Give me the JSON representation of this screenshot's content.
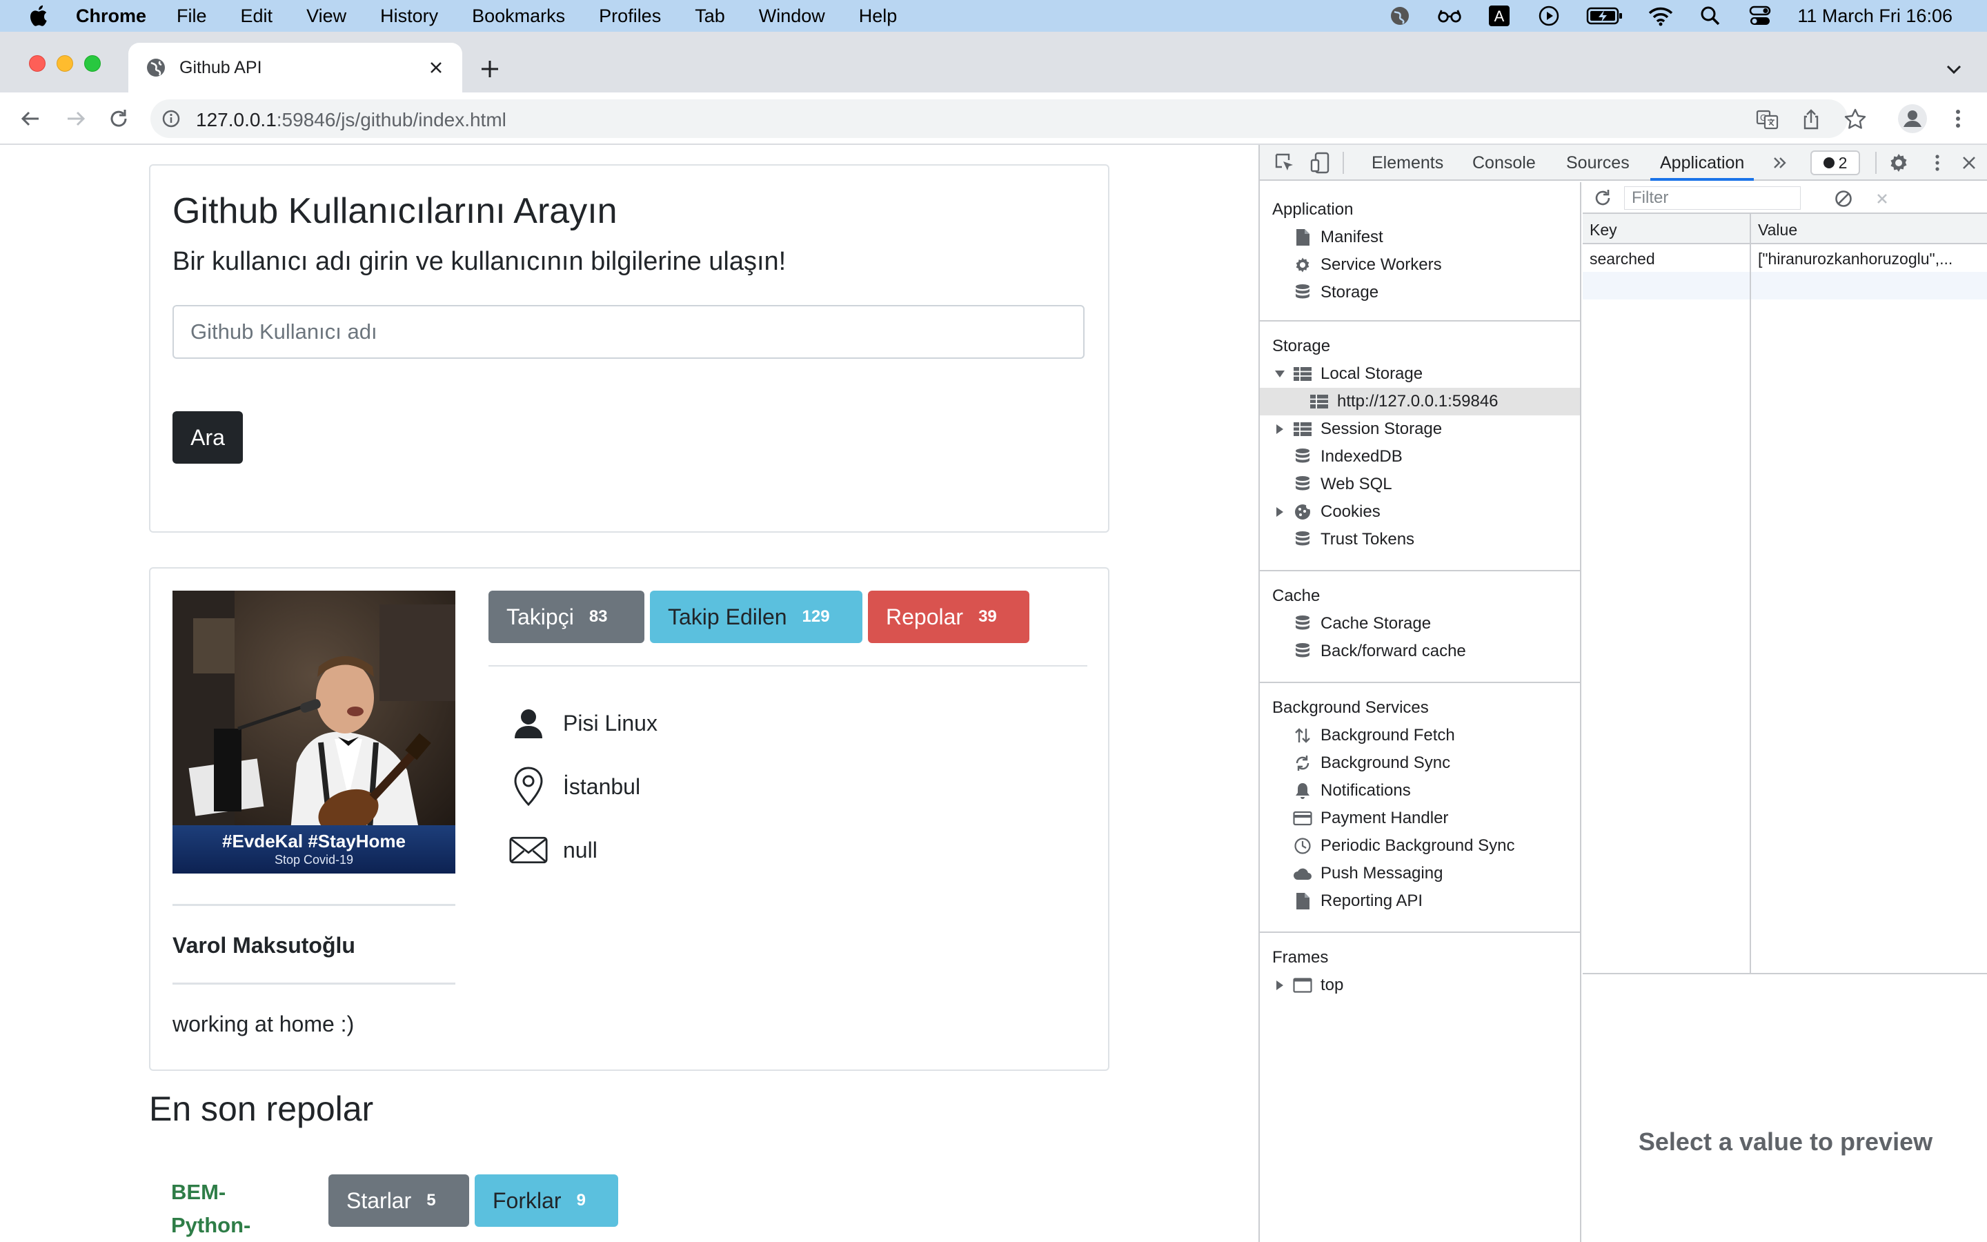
{
  "menubar": {
    "app_name": "Chrome",
    "menus": [
      "File",
      "Edit",
      "View",
      "History",
      "Bookmarks",
      "Profiles",
      "Tab",
      "Window",
      "Help"
    ],
    "clock": "11 March Fri  16:06"
  },
  "browser": {
    "tab_title": "Github API",
    "url_host": "127.0.0.1",
    "url_rest": ":59846/js/github/index.html"
  },
  "page": {
    "search": {
      "title": "Github Kullanıcılarını Arayın",
      "subtitle": "Bir kullanıcı adı girin ve kullanıcının bilgilerine ulaşın!",
      "placeholder": "Github Kullanıcı adı",
      "value": "",
      "button": "Ara"
    },
    "profile": {
      "avatar_caption_main": "#EvdeKal #StayHome",
      "avatar_caption_sub": "Stop Covid-19",
      "name": "Varol Maksutoğlu",
      "bio": "working at home :)",
      "followers_label": "Takipçi",
      "followers_count": "83",
      "following_label": "Takip Edilen",
      "following_count": "129",
      "repos_label": "Repolar",
      "repos_count": "39",
      "company": "Pisi Linux",
      "location": "İstanbul",
      "email": "null"
    },
    "repos": {
      "heading": "En son repolar",
      "first_repo_name_line1": "BEM-",
      "first_repo_name_line2": "Python-",
      "stars_label": "Starlar",
      "stars_count": "5",
      "forks_label": "Forklar",
      "forks_count": "9"
    }
  },
  "devtools": {
    "tabs": [
      "Elements",
      "Console",
      "Sources",
      "Application"
    ],
    "active_tab": "Application",
    "issues_count": "2",
    "sidebar": {
      "application": {
        "title": "Application",
        "items": [
          "Manifest",
          "Service Workers",
          "Storage"
        ]
      },
      "storage": {
        "title": "Storage",
        "local_storage": "Local Storage",
        "local_origin": "http://127.0.0.1:59846",
        "session_storage": "Session Storage",
        "indexeddb": "IndexedDB",
        "websql": "Web SQL",
        "cookies": "Cookies",
        "trust_tokens": "Trust Tokens"
      },
      "cache": {
        "title": "Cache",
        "items": [
          "Cache Storage",
          "Back/forward cache"
        ]
      },
      "background": {
        "title": "Background Services",
        "items": [
          "Background Fetch",
          "Background Sync",
          "Notifications",
          "Payment Handler",
          "Periodic Background Sync",
          "Push Messaging",
          "Reporting API"
        ]
      },
      "frames": {
        "title": "Frames",
        "top": "top"
      }
    },
    "main": {
      "filter_placeholder": "Filter",
      "col_key": "Key",
      "col_value": "Value",
      "rows": [
        {
          "key": "searched",
          "value": "[\"hiranurozkanhoruzoglu\",..."
        }
      ],
      "preview_text": "Select a value to preview"
    }
  },
  "colors": {
    "followers": "#6c757d",
    "following": "#5bc0de",
    "repos": "#d9534f",
    "primary_dark": "#212529",
    "repo_link": "#2e7d47",
    "devtools_accent": "#1a73e8"
  }
}
